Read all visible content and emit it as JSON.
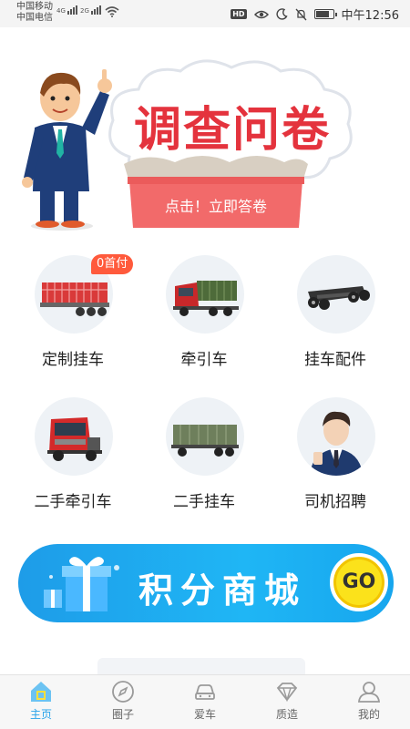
{
  "status_bar": {
    "carrier1": "中国移动",
    "carrier2": "中国电信",
    "net1": "4G",
    "net2": "2G",
    "hd": "HD",
    "time": "中午12:56"
  },
  "banner": {
    "title": "调查问卷",
    "button": "点击！立即答卷"
  },
  "categories": [
    {
      "label": "定制挂车",
      "badge": "0首付",
      "icon": "flatbed-trailer-icon"
    },
    {
      "label": "牵引车",
      "icon": "tractor-truck-icon"
    },
    {
      "label": "挂车配件",
      "icon": "chassis-parts-icon"
    },
    {
      "label": "二手牵引车",
      "icon": "used-tractor-icon"
    },
    {
      "label": "二手挂车",
      "icon": "used-trailer-icon"
    },
    {
      "label": "司机招聘",
      "icon": "driver-photo-icon"
    }
  ],
  "mall": {
    "title": "积分商城",
    "go": "GO"
  },
  "tabs": [
    {
      "label": "主页",
      "icon": "home-icon",
      "active": true
    },
    {
      "label": "圈子",
      "icon": "compass-icon"
    },
    {
      "label": "爱车",
      "icon": "car-icon"
    },
    {
      "label": "质造",
      "icon": "diamond-icon"
    },
    {
      "label": "我的",
      "icon": "user-icon"
    }
  ],
  "colors": {
    "accent": "#29a3ea",
    "survey_red": "#e4333d",
    "badge": "#ff5a3c",
    "mall_blue": "#1fb6f5",
    "go_yellow": "#fbe21b"
  }
}
